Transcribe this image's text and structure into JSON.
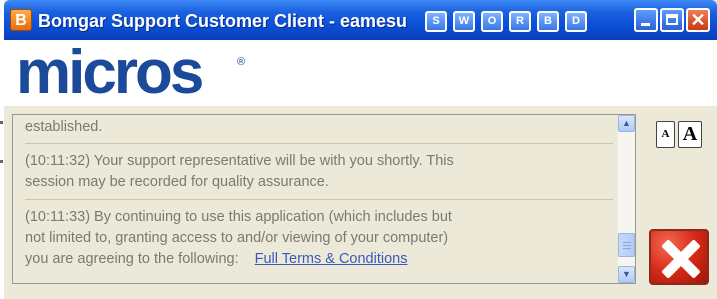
{
  "window": {
    "title": "Bomgar Support Customer Client - eamesu",
    "app_icon_letter": "B"
  },
  "session_buttons": [
    "S",
    "W",
    "O",
    "R",
    "B",
    "D"
  ],
  "window_controls": {
    "minimize_icon": "minimize-icon",
    "maximize_icon": "maximize-icon",
    "close_icon": "close-icon"
  },
  "brand": {
    "logo_text": "micros",
    "registered": "®",
    "color": "#1a4a99"
  },
  "chat_log": {
    "entries": [
      {
        "text": "established."
      },
      {
        "line1": "(10:11:32)  Your support representative will be with you shortly. This",
        "line2": "session may be recorded for quality assurance."
      },
      {
        "line1": "(10:11:33)  By continuing to use this application (which includes but",
        "line2": "not limited to, granting access to and/or viewing of your computer)",
        "line3": "you are agreeing to the following:",
        "link": "Full Terms & Conditions"
      }
    ]
  },
  "font_controls": {
    "decrease_label": "A",
    "increase_label": "A"
  },
  "end_session": {
    "icon": "end-session-x-icon",
    "color": "#d82a18"
  },
  "colors": {
    "titlebar": "#0a4fd6",
    "panel": "#ece9d8",
    "text": "#7a7a72",
    "link": "#3a5bbb"
  }
}
